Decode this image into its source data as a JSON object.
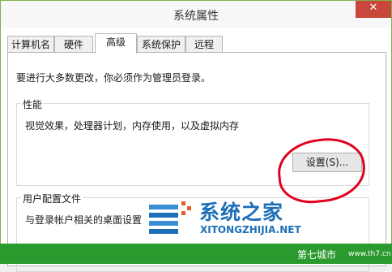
{
  "window": {
    "title": "系统属性",
    "close_icon": "close-icon"
  },
  "tabs": [
    "计算机名",
    "硬件",
    "高级",
    "系统保护",
    "远程"
  ],
  "active_tab": "高级",
  "panel": {
    "notice": "要进行大多数更改，你必须作为管理员登录。",
    "performance": {
      "label": "性能",
      "description": "视觉效果，处理器计划，内存使用，以及虚拟内存",
      "settings_button": "设置(S)..."
    },
    "user_profile": {
      "label": "用户配置文件",
      "description": "与登录帐户相关的桌面设置"
    }
  },
  "watermark": {
    "title": "系统之家",
    "url": "XITONGZHIJIA.NET"
  },
  "status_bar": {
    "text": "第七城市",
    "sub": "www.th7.cn"
  },
  "colors": {
    "annotation": "#e0001f",
    "watermark": "#1d6fb8",
    "status_bar": "#2a9a2f"
  }
}
